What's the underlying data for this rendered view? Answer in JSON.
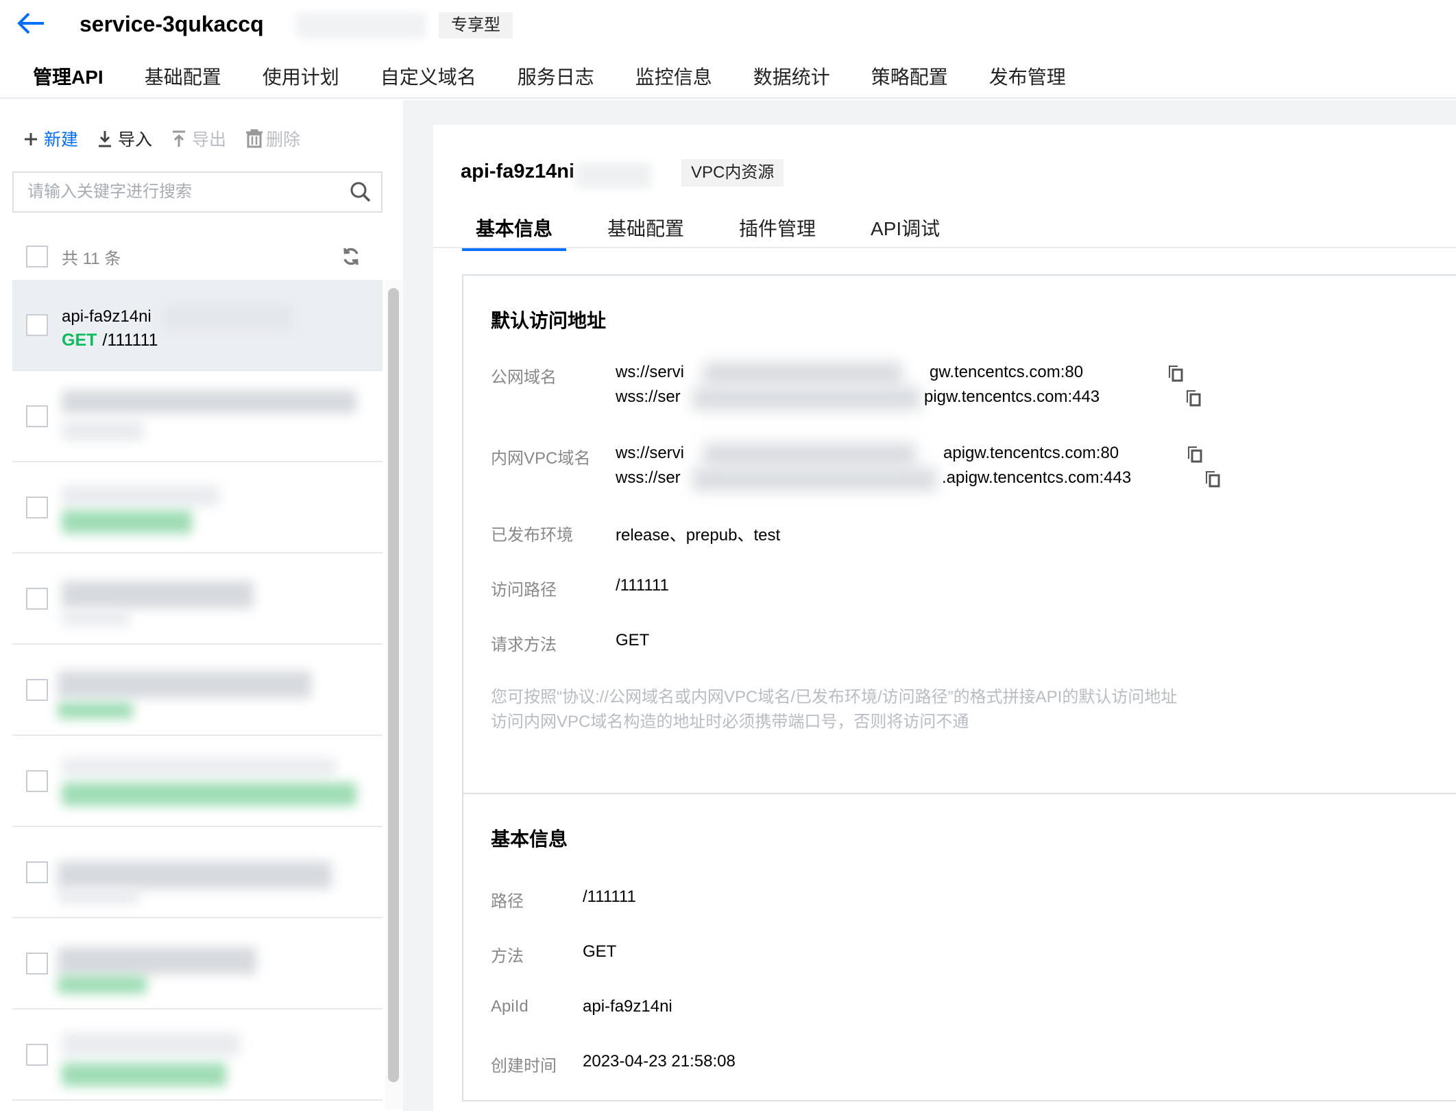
{
  "header": {
    "service_name": "service-3qukaccq",
    "service_badge": "专享型",
    "tabs": [
      {
        "label": "管理API",
        "active": true
      },
      {
        "label": "基础配置",
        "active": false
      },
      {
        "label": "使用计划",
        "active": false
      },
      {
        "label": "自定义域名",
        "active": false
      },
      {
        "label": "服务日志",
        "active": false
      },
      {
        "label": "监控信息",
        "active": false
      },
      {
        "label": "数据统计",
        "active": false
      },
      {
        "label": "策略配置",
        "active": false
      },
      {
        "label": "发布管理",
        "active": false
      }
    ]
  },
  "toolbar": {
    "new_label": "新建",
    "import_label": "导入",
    "export_label": "导出",
    "delete_label": "删除"
  },
  "search": {
    "placeholder": "请输入关键字进行搜索"
  },
  "list": {
    "count_text": "共 11 条",
    "items": [
      {
        "name": "api-fa9z14ni",
        "method": "GET",
        "path": "/111111"
      }
    ]
  },
  "detail": {
    "api_id": "api-fa9z14ni",
    "badge": "VPC内资源",
    "tabs": [
      {
        "label": "基本信息",
        "active": true
      },
      {
        "label": "基础配置",
        "active": false
      },
      {
        "label": "插件管理",
        "active": false
      },
      {
        "label": "API调试",
        "active": false
      }
    ],
    "access": {
      "title": "默认访问地址",
      "public_domain_label": "公网域名",
      "public_ws_start": "ws://servi",
      "public_ws_end": "gw.tencentcs.com:80",
      "public_wss_start": "wss://ser",
      "public_wss_end": "pigw.tencentcs.com:443",
      "vpc_domain_label": "内网VPC域名",
      "vpc_ws_start": "ws://servi",
      "vpc_ws_end": "apigw.tencentcs.com:80",
      "vpc_wss_start": "wss://ser",
      "vpc_wss_end": ".apigw.tencentcs.com:443",
      "env_label": "已发布环境",
      "env_value": "release、prepub、test",
      "path_label": "访问路径",
      "path_value": "/111111",
      "method_label": "请求方法",
      "method_value": "GET",
      "note_line1": "您可按照“协议://公网域名或内网VPC域名/已发布环境/访问路径”的格式拼接API的默认访问地址",
      "note_line2": "访问内网VPC域名构造的地址时必须携带端口号，否则将访问不通"
    },
    "basic": {
      "title": "基本信息",
      "path_label": "路径",
      "path_value": "/111111",
      "method_label": "方法",
      "method_value": "GET",
      "apiid_label": "ApiId",
      "apiid_value": "api-fa9z14ni",
      "created_label": "创建时间",
      "created_value": "2023-04-23 21:58:08"
    }
  },
  "colors": {
    "accent": "#006eff",
    "method_get": "#0abf5b",
    "page_bg": "#f2f3f5",
    "muted_text": "#888888"
  }
}
